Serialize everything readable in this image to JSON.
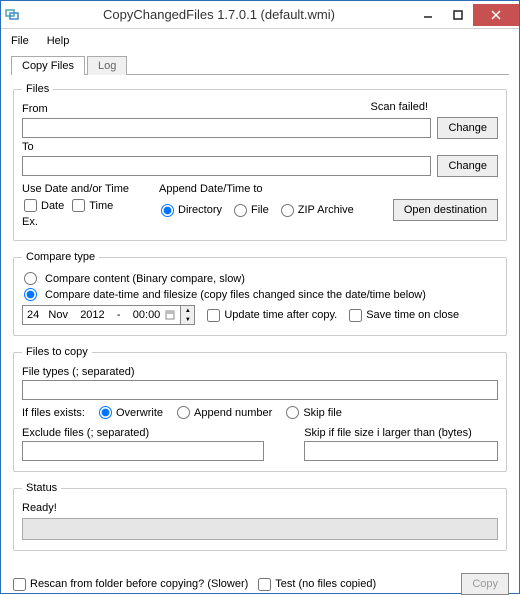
{
  "window": {
    "title": "CopyChangedFiles 1.7.0.1 (default.wmi)"
  },
  "menu": {
    "file": "File",
    "help": "Help"
  },
  "tabs": {
    "copy_files": "Copy Files",
    "log": "Log"
  },
  "files": {
    "legend": "Files",
    "from_label": "From",
    "scan_failed": "Scan failed!",
    "from_value": "",
    "change1": "Change",
    "to_label": "To",
    "to_value": "",
    "change2": "Change",
    "use_dt_label": "Use Date and/or Time",
    "cb_date": "Date",
    "cb_time": "Time",
    "ex_label": "Ex.",
    "append_label": "Append Date/Time to",
    "r_directory": "Directory",
    "r_file": "File",
    "r_zip": "ZIP Archive",
    "open_dest": "Open destination"
  },
  "compare": {
    "legend": "Compare type",
    "r_content": "Compare content (Binary compare, slow)",
    "r_datetime": "Compare date-time and filesize (copy files changed since the date/time below)",
    "date_value": "24   Nov    2012    -    00:00",
    "cb_update": "Update time after copy.",
    "cb_save": "Save time on close"
  },
  "filescopy": {
    "legend": "Files to copy",
    "types_label": "File types (; separated)",
    "types_value": "",
    "if_exists": "If files exists:",
    "r_overwrite": "Overwrite",
    "r_append": "Append number",
    "r_skip": "Skip file",
    "excl_label": "Exclude files (; separated)",
    "excl_value": "",
    "skipsize_label": "Skip if file size i larger than (bytes)",
    "skipsize_value": ""
  },
  "status": {
    "legend": "Status",
    "ready": "Ready!"
  },
  "bottom": {
    "cb_rescan": "Rescan from folder before copying? (Slower)",
    "cb_test": "Test (no files copied)",
    "copy_btn": "Copy"
  }
}
